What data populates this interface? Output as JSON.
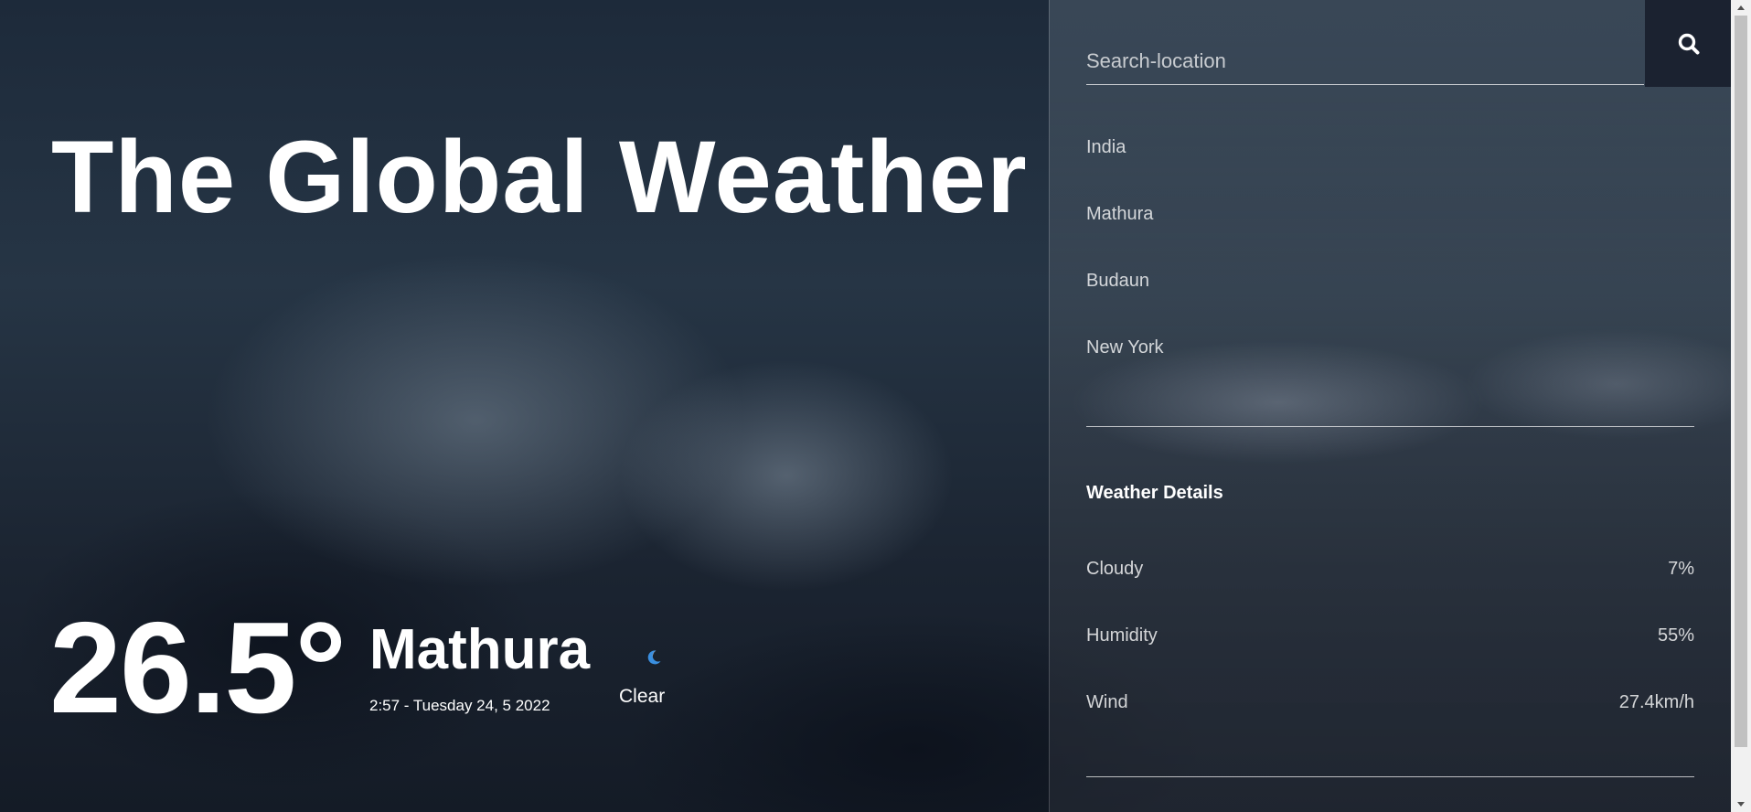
{
  "main": {
    "title": "The Global Weather",
    "temperature": "26.5°",
    "city": "Mathura",
    "datetime": "2:57 - Tuesday 24, 5 2022",
    "condition": "Clear",
    "condition_icon": "moon-icon"
  },
  "sidebar": {
    "search": {
      "placeholder": "Search-location",
      "value": "",
      "icon": "search-icon"
    },
    "locations": [
      "India",
      "Mathura",
      "Budaun",
      "New York"
    ],
    "details_heading": "Weather Details",
    "details": [
      {
        "label": "Cloudy",
        "value": "7%"
      },
      {
        "label": "Humidity",
        "value": "55%"
      },
      {
        "label": "Wind",
        "value": "27.4km/h"
      }
    ]
  },
  "colors": {
    "search_button_bg": "#1b2230",
    "moon_icon": "#3a8fe0",
    "text": "#ffffff"
  }
}
